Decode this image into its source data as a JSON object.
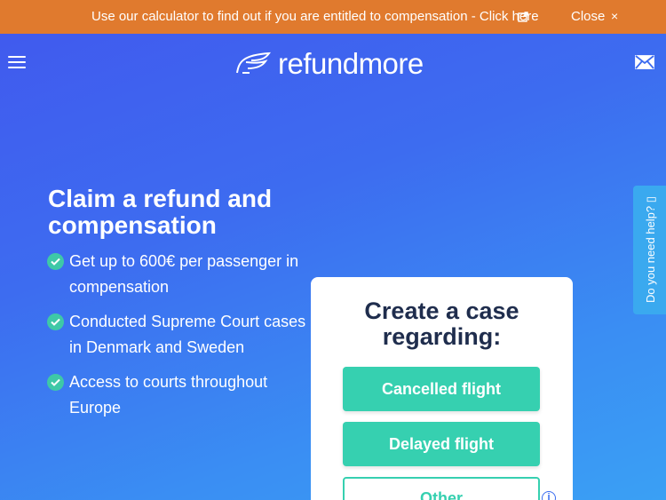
{
  "banner": {
    "text": "Use our calculator to find out if you are entitled to compensation - Click here",
    "close_label": "Close",
    "close_symbol": "×",
    "link_icon": "external-link-icon",
    "color": "#e07a2e"
  },
  "header": {
    "menu_icon": "hamburger-menu-icon",
    "logo_text": "refundmore",
    "mail_icon": "mail-icon"
  },
  "hero": {
    "title": "Claim a refund and compensation",
    "features": [
      "Get up to 600€ per passenger in compensation",
      "Conducted Supreme Court cases in Denmark and Sweden",
      "Access to courts throughout Europe"
    ]
  },
  "card": {
    "title": "Create a case regarding:",
    "buttons": {
      "cancelled": "Cancelled flight",
      "delayed": "Delayed flight",
      "other": "Other"
    },
    "info_symbol": "i",
    "accent_color": "#36d0b0"
  },
  "help_tab": {
    "label": "Do you need help? ▯"
  }
}
